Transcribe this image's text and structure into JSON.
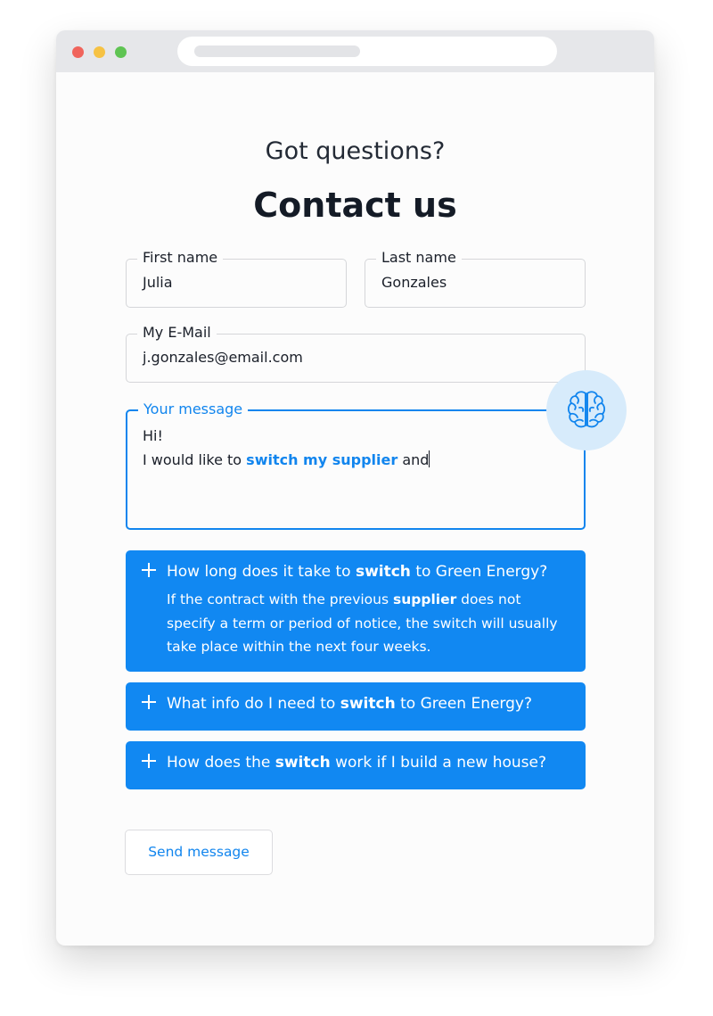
{
  "header": {
    "subtitle": "Got questions?",
    "title": "Contact us"
  },
  "form": {
    "first_name": {
      "label": "First name",
      "value": "Julia"
    },
    "last_name": {
      "label": "Last name",
      "value": "Gonzales"
    },
    "email": {
      "label": "My E-Mail",
      "value": "j.gonzales@email.com"
    },
    "message": {
      "label": "Your message",
      "line1": "Hi!",
      "line2_before": "I would like to ",
      "line2_highlight": "switch my supplier",
      "line2_after": " and"
    },
    "ai_assistant_icon": "brain-icon"
  },
  "faq": [
    {
      "q_before": "How long does it take to ",
      "q_bold": "switch",
      "q_after": " to Green Energy?",
      "a_before": "If the contract with the previous ",
      "a_bold": "supplier",
      "a_after": " does not specify a term or period of notice, the switch will usually take place within the next four weeks.",
      "expanded": true
    },
    {
      "q_before": "What info do I need to ",
      "q_bold": "switch",
      "q_after": " to Green Energy?",
      "expanded": false
    },
    {
      "q_before": "How does the ",
      "q_bold": "switch",
      "q_after": " work if I build a new house?",
      "expanded": false
    }
  ],
  "send_button": "Send message",
  "colors": {
    "accent": "#1188f2",
    "assistant_bg": "#d7ebfb",
    "text": "#1a1f29"
  }
}
